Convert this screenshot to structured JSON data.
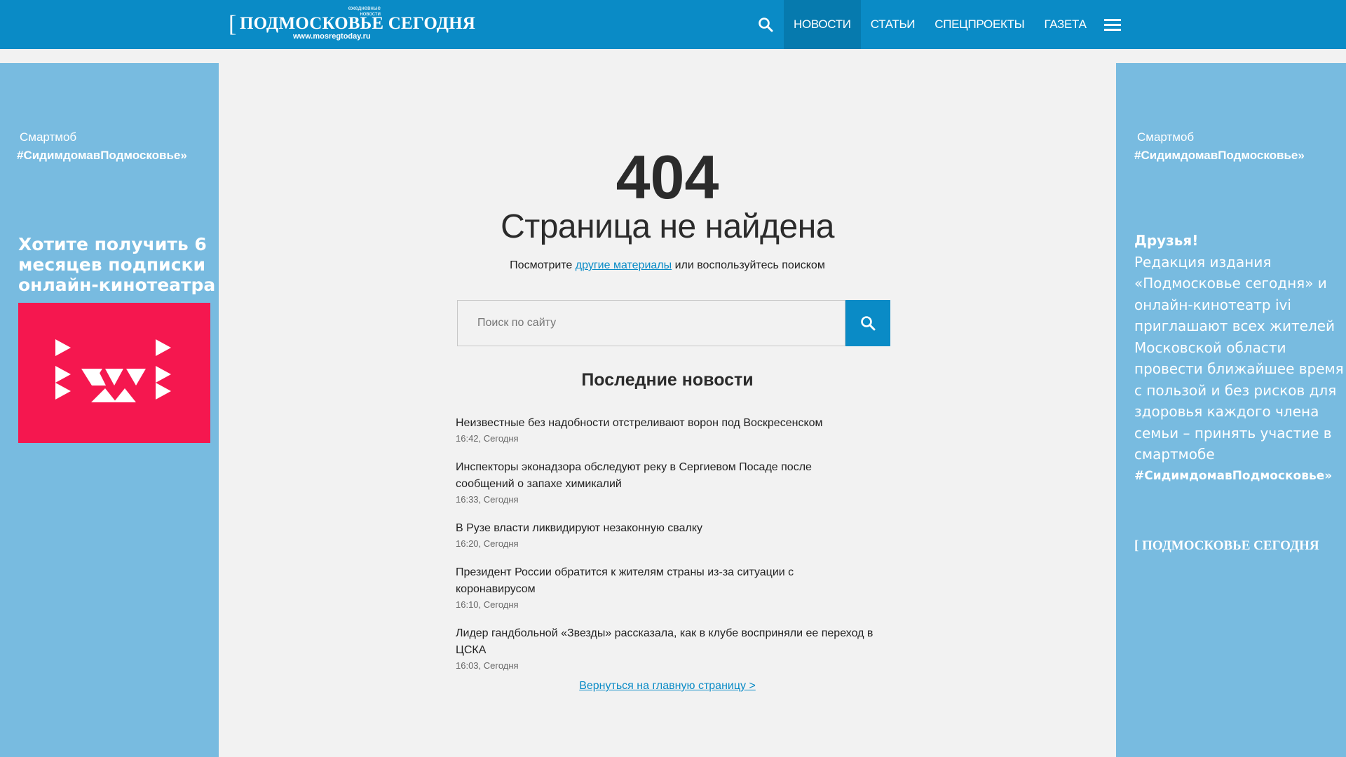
{
  "header": {
    "logo": {
      "bracket": "[",
      "title": "ПОДМОСКОВЬЕ СЕГОДНЯ",
      "tagline": "ежедневные новости",
      "url": "www.mosregtoday.ru"
    },
    "nav": [
      {
        "label": "НОВОСТИ",
        "active": true
      },
      {
        "label": "СТАТЬИ",
        "active": false
      },
      {
        "label": "СПЕЦПРОЕКТЫ",
        "active": false
      },
      {
        "label": "ГАЗЕТА",
        "active": false
      }
    ],
    "icons": {
      "search": "search-icon",
      "menu": "hamburger-menu-icon"
    }
  },
  "left_banner": {
    "small": "Смартмоб",
    "hashtag": "#СидимдомавПодмосковье»",
    "promo": "Хотите получить 6 месяцев подписки онлайн-кинотеатра",
    "logo_name": "ivi-logo"
  },
  "right_banner": {
    "small": "Смартмоб",
    "hashtag": "#СидимдомавПодмосковье»",
    "greeting": "Друзья!",
    "text": "Редакция издания «Подмосковье сегодня» и онлайн-кинотеатр ivi приглашают всех жителей Московской области провести ближайшее время с пользой и без рисков для здоровья каждого члена семьи – принять участие в смартмобе",
    "hashtag2": "#СидимдомавПодмосковье»",
    "brand": "[ ПОДМОСКОВЬЕ СЕГОДНЯ"
  },
  "error": {
    "code": "404",
    "title": "Страница не найдена",
    "hint_before": "Посмотрите ",
    "hint_link": "другие материалы",
    "hint_after": " или воспользуйтесь поиском"
  },
  "search": {
    "placeholder": "Поиск по сайту"
  },
  "news": {
    "heading": "Последние новости",
    "items": [
      {
        "title": "Неизвестные без надобности отстреливают ворон под Воскресенском",
        "meta": "16:42, Сегодня"
      },
      {
        "title": "Инспекторы эконадзора обследуют реку в Сергиевом Посаде после сообщений о запахе химикалий",
        "meta": "16:33, Сегодня"
      },
      {
        "title": "В Рузе власти ликвидируют незаконную свалку",
        "meta": "16:20, Сегодня"
      },
      {
        "title": "Президент России обратится к жителям страны из-за ситуации с коронавирусом",
        "meta": "16:10, Сегодня"
      },
      {
        "title": "Лидер гандбольной «Звезды» рассказала, как в клубе восприняли ее переход в ЦСКА",
        "meta": "16:03, Сегодня"
      }
    ]
  },
  "back_link": "Вернуться на главную страницу >",
  "colors": {
    "brand": "#0a8bc6",
    "nav_active": "#067aae",
    "banner": "#78bbe0",
    "ivi": "#f5174f",
    "page_bg": "#f2f2f2"
  }
}
